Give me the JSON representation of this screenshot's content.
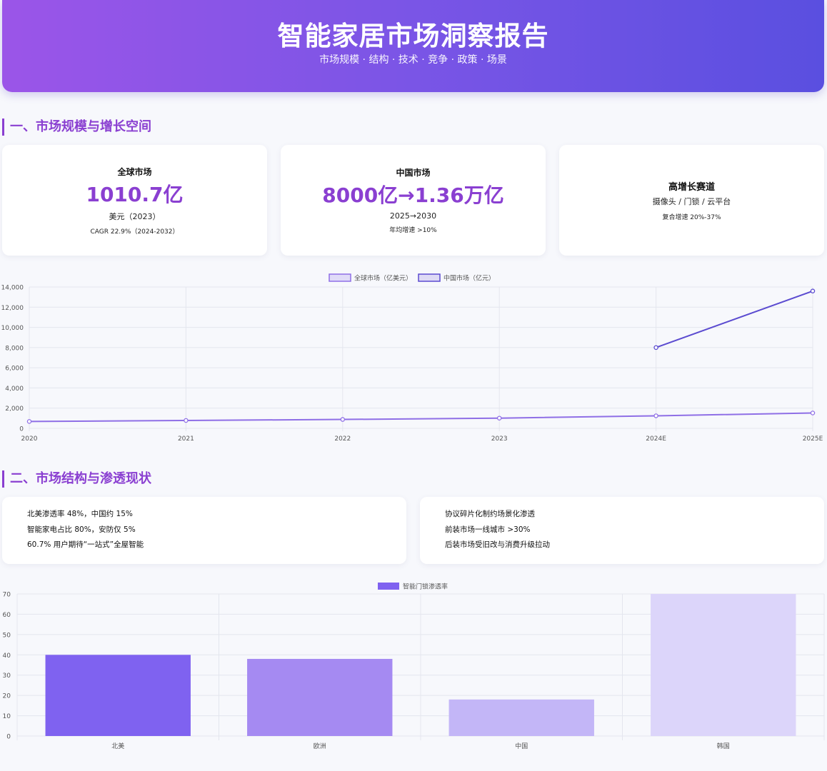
{
  "header": {
    "title": "智能家居市场洞察报告",
    "subtitle": "市场规模 · 结构 · 技术 · 竞争 · 政策 · 场景"
  },
  "section1": {
    "title": "一、市场规模与增长空间"
  },
  "kpis": [
    {
      "label": "全球市场",
      "value": "1010.7亿",
      "unit": "美元（2023）",
      "note": "CAGR 22.9%（2024-2032）"
    },
    {
      "label": "中国市场",
      "value": "8000亿→1.36万亿",
      "unit": "2025→2030",
      "note": "年均增速 >10%"
    },
    {
      "label": "高增长赛道",
      "line1": "摄像头 / 门锁 / 云平台",
      "line2": "复合增速 20%-37%"
    }
  ],
  "section2": {
    "title": "二、市场结构与渗透现状"
  },
  "structure_left": [
    "北美渗透率 48%，中国约 15%",
    "智能家电占比 80%，安防仅 5%",
    "60.7% 用户期待“一站式”全屋智能"
  ],
  "structure_right": [
    "协议碎片化制约场景化渗透",
    "前装市场一线城市 >30%",
    "后装市场受旧改与消费升级拉动"
  ],
  "colors": {
    "accent": "#8a3fd1",
    "global_line": "#8f6fe6",
    "china_line": "#5b4bd0"
  },
  "chart_data": [
    {
      "type": "line",
      "categories": [
        "2020",
        "2021",
        "2022",
        "2023",
        "2024E",
        "2025E"
      ],
      "series": [
        {
          "name": "全球市场（亿美元）",
          "values": [
            680,
            780,
            880,
            1010.7,
            1240,
            1520
          ],
          "color": "#8f6fe6"
        },
        {
          "name": "中国市场（亿元）",
          "values": [
            null,
            null,
            null,
            null,
            8000,
            13600
          ],
          "color": "#5b4bd0"
        }
      ],
      "yticks": [
        "0",
        "2,000",
        "4,000",
        "6,000",
        "8,000",
        "10,000",
        "12,000",
        "14,000"
      ],
      "ylim": [
        0,
        14000
      ],
      "grid": true,
      "legend": "top-center"
    },
    {
      "type": "bar",
      "categories": [
        "北美",
        "欧洲",
        "中国",
        "韩国"
      ],
      "series": [
        {
          "name": "智能门锁渗透率",
          "values": [
            40,
            38,
            18,
            70
          ]
        }
      ],
      "colors": [
        "#7f62f0",
        "#a58af2",
        "#c3b6f7",
        "#dcd5fa"
      ],
      "yticks": [
        "0",
        "10",
        "20",
        "30",
        "40",
        "50",
        "60",
        "70"
      ],
      "ylim": [
        0,
        70
      ],
      "grid": true,
      "legend": "top-center"
    }
  ]
}
